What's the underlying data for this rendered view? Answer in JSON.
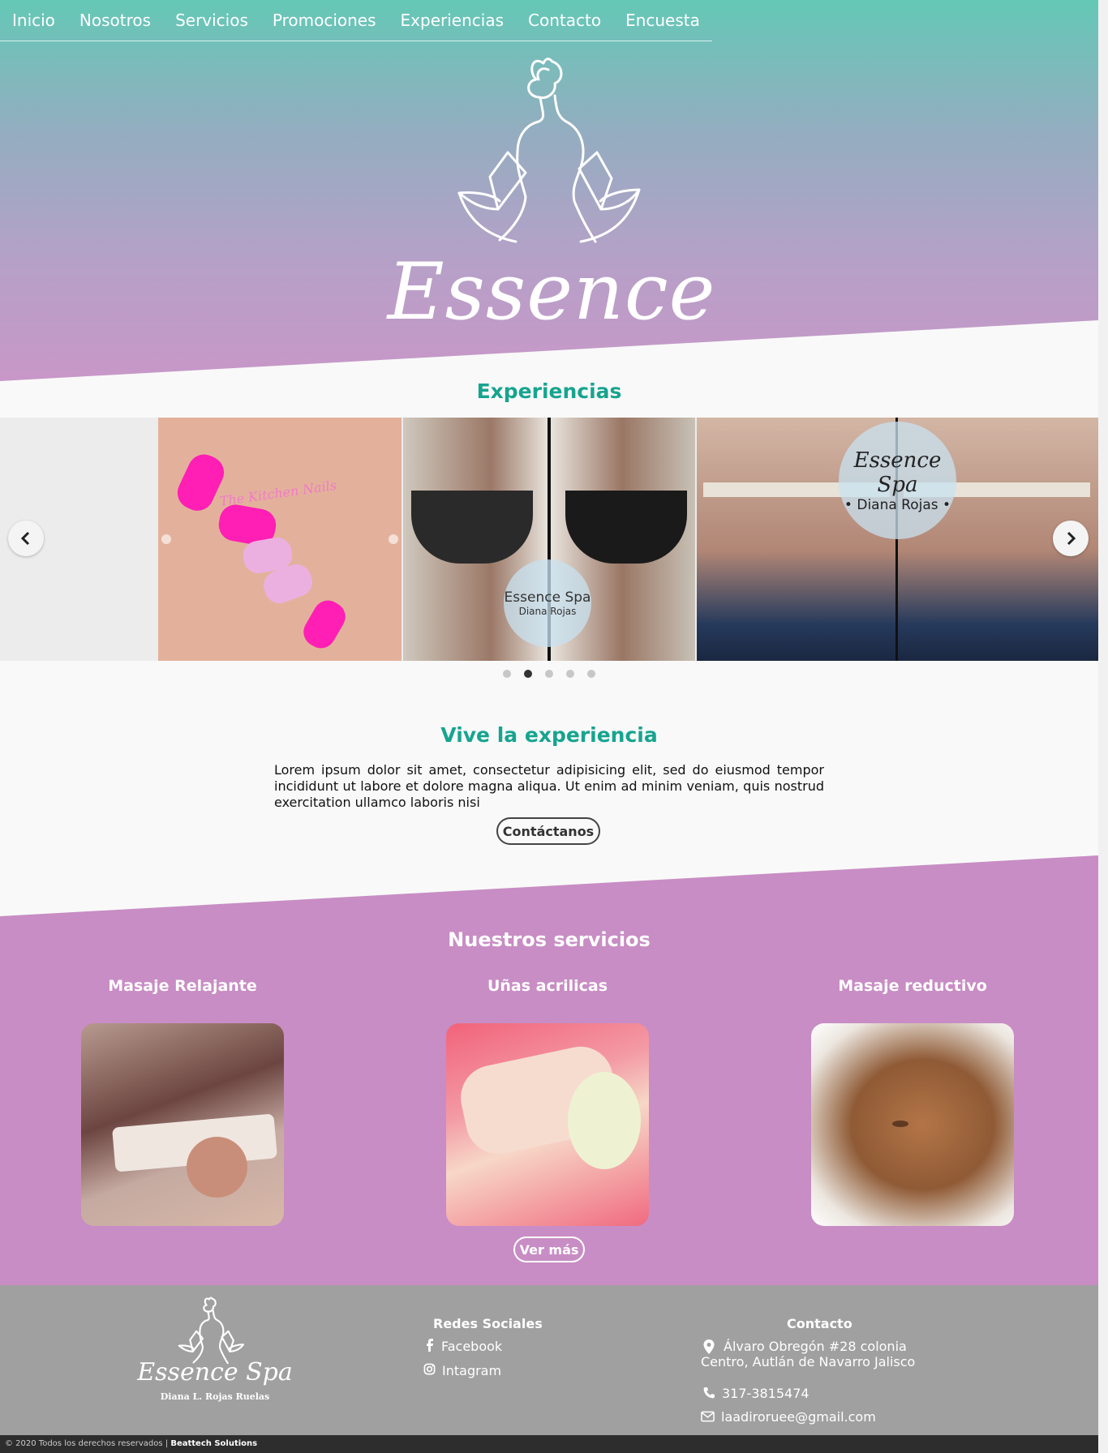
{
  "nav": {
    "items": [
      "Inicio",
      "Nosotros",
      "Servicios",
      "Promociones",
      "Experiencias",
      "Contacto",
      "Encuesta"
    ]
  },
  "hero": {
    "logo_text": "Essence Spa"
  },
  "experiences": {
    "title": "Experiencias",
    "badge_1": {
      "name": "Essence Spa",
      "sub": "Diana Rojas"
    },
    "badge_2": {
      "name": "Essence Spa",
      "sub": "• Diana Rojas •"
    },
    "nail_caption": "The Kitchen Nails",
    "active_slide": 2,
    "slide_count": 5
  },
  "vive": {
    "title": "Vive la experiencia",
    "text": "Lorem ipsum dolor sit amet, consectetur adipisicing elit, sed do eiusmod tempor incididunt ut labore et dolore magna aliqua. Ut enim ad minim veniam, quis nostrud exercitation ullamco laboris nisi",
    "button": "Contáctanos"
  },
  "services": {
    "title": "Nuestros servicios",
    "items": [
      {
        "name": "Masaje Relajante"
      },
      {
        "name": "Uñas acrilicas"
      },
      {
        "name": "Masaje reductivo"
      }
    ],
    "button": "Ver más"
  },
  "footer": {
    "logo_text": "Essence Spa",
    "logo_sub": "Diana L. Rojas Ruelas",
    "social_title": "Redes Sociales",
    "facebook": "Facebook",
    "instagram": "Intagram",
    "contact_title": "Contacto",
    "address_1": "Álvaro Obregón #28 colonia",
    "address_2": "Centro, Autlán de Navarro Jalisco",
    "phone": "317-3815474",
    "email": "laadiroruee@gmail.com"
  },
  "copyright": {
    "text": "© 2020 Todos los derechos reservados | ",
    "brand": "Beattech Solutions"
  },
  "colors": {
    "teal": "#17a48f",
    "purple": "#c88dc4",
    "footer": "#a0a0a0"
  }
}
